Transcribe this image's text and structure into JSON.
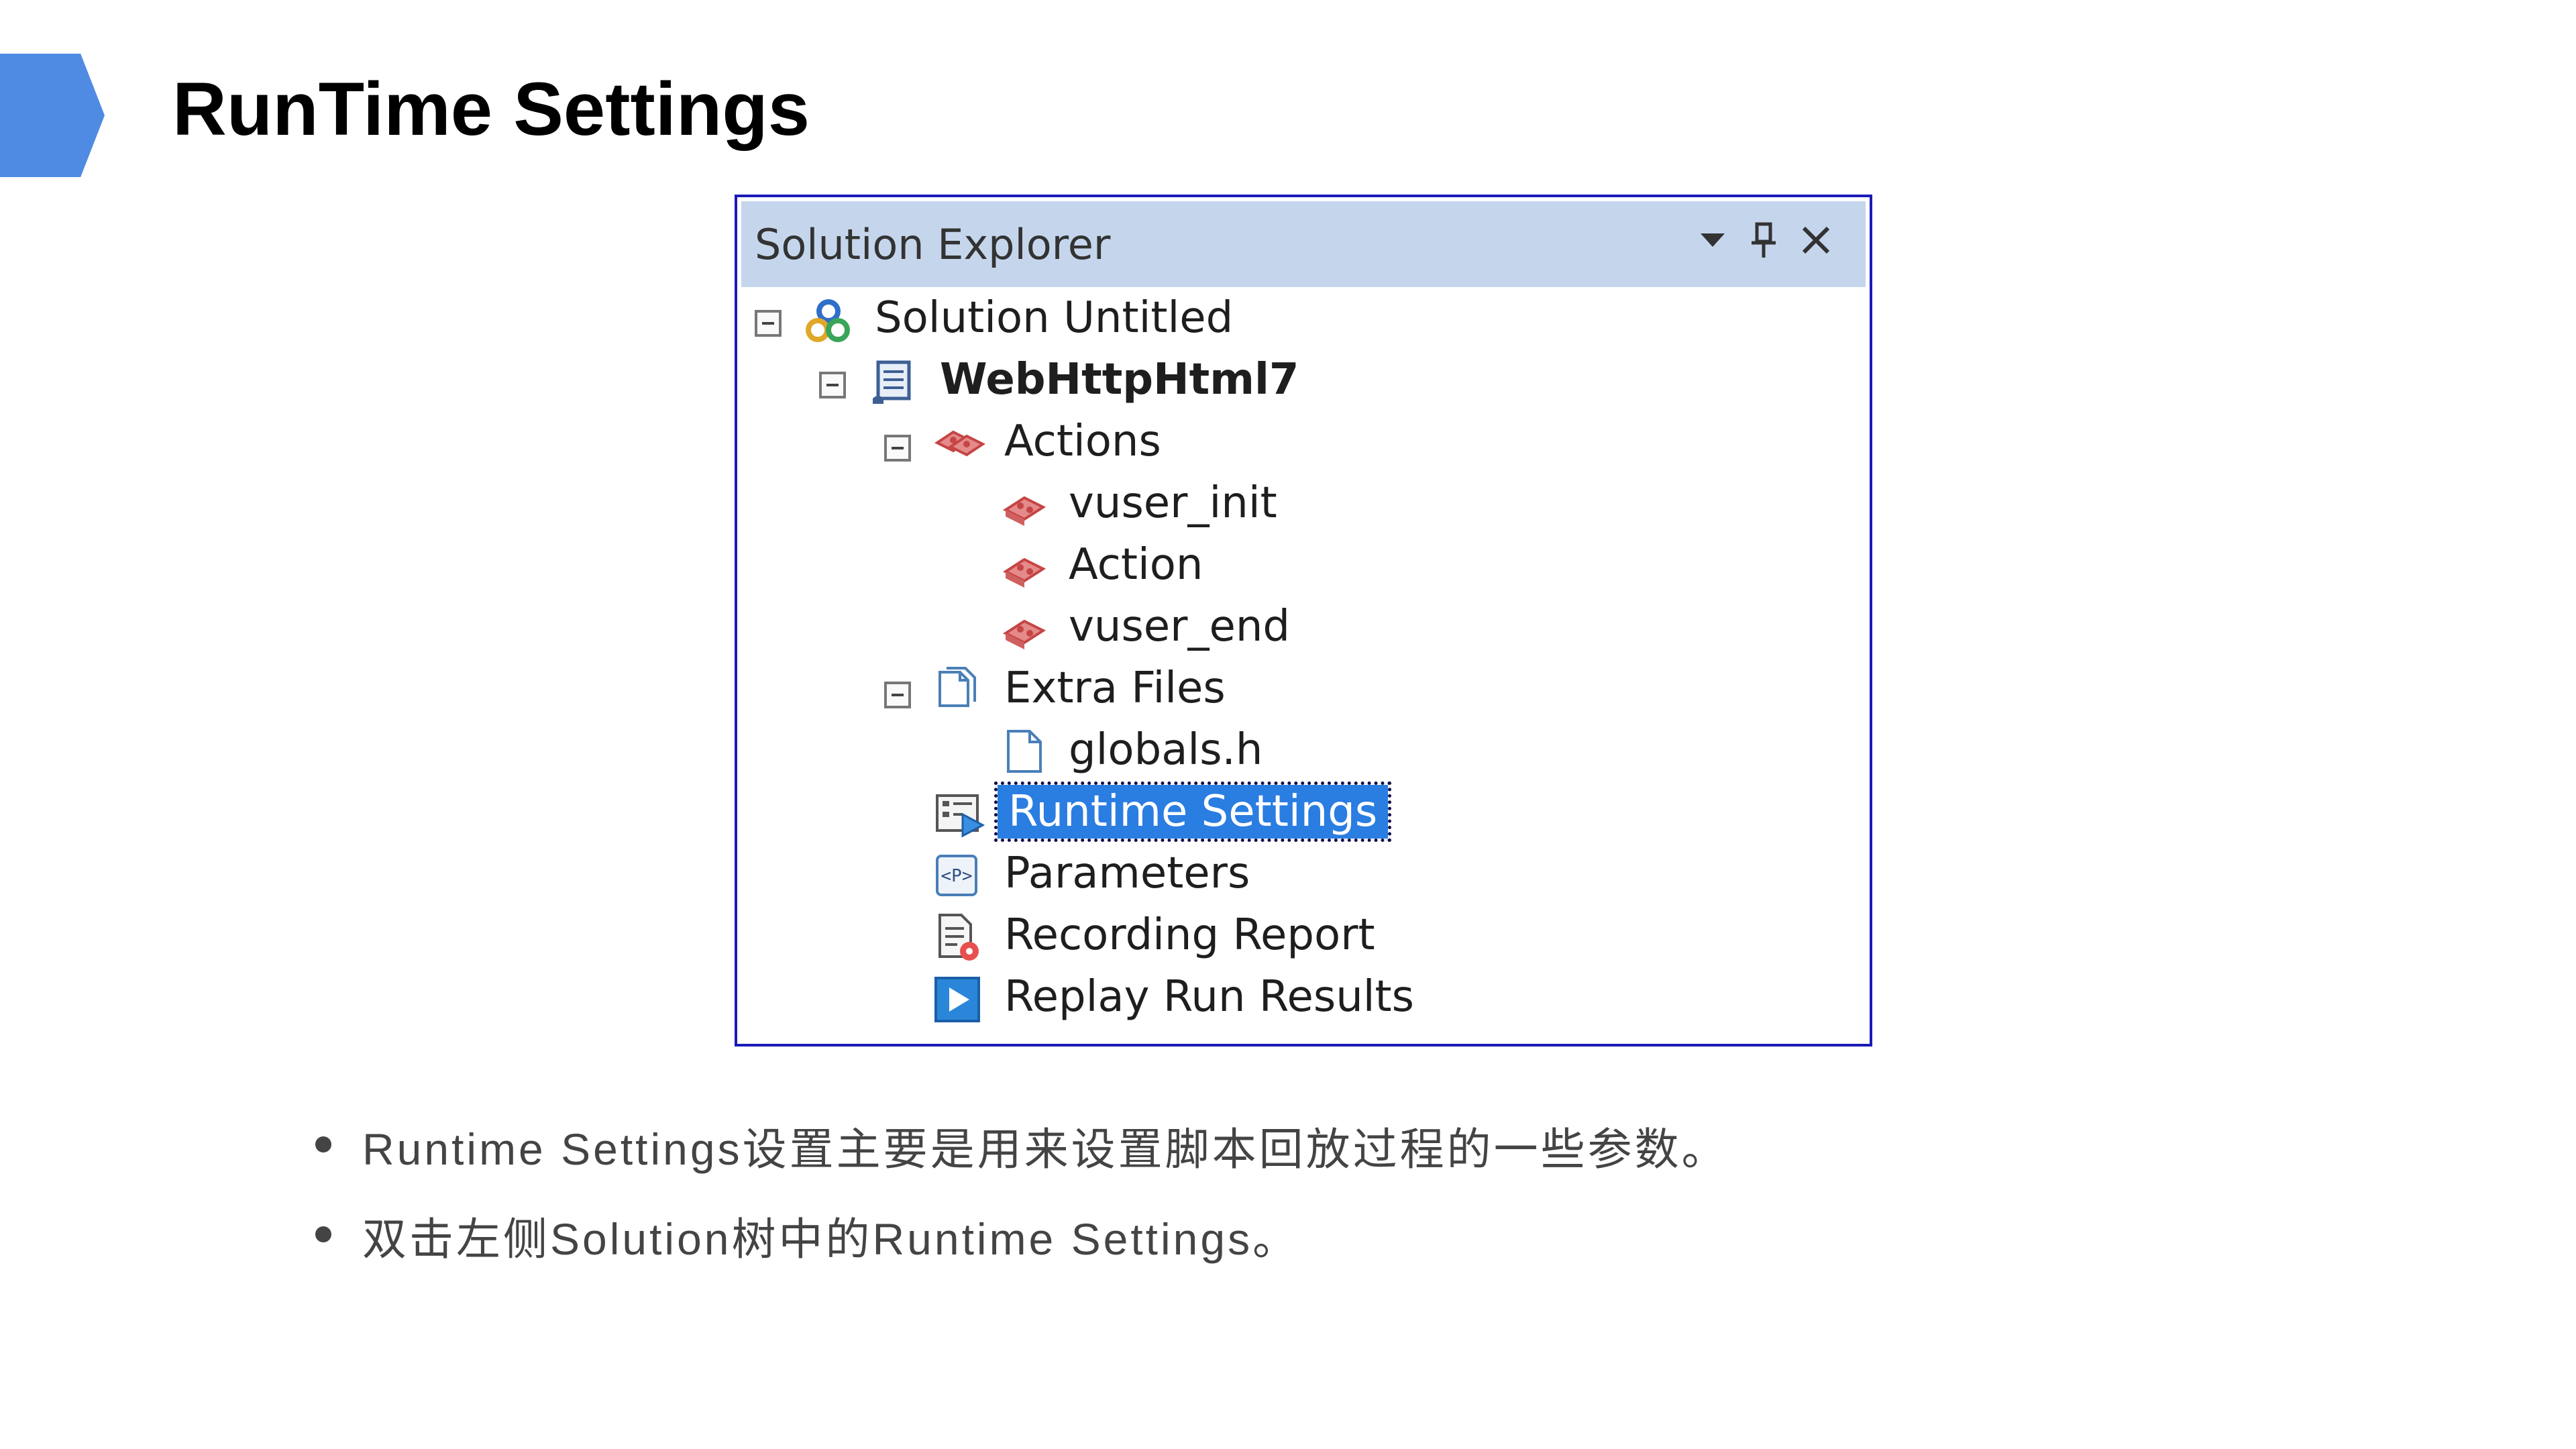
{
  "slide": {
    "title": "RunTime Settings",
    "accent_color": "#4f8be3"
  },
  "explorer": {
    "title": "Solution Explorer",
    "header_icons": [
      "dropdown-arrow-icon",
      "pin-icon",
      "close-icon"
    ],
    "tree": [
      {
        "label": "Solution Untitled",
        "icon": "solution-icon",
        "expanded": true
      },
      {
        "label": "WebHttpHtml7",
        "icon": "script-icon",
        "expanded": true,
        "bold": true
      },
      {
        "label": "Actions",
        "icon": "actions-icon",
        "expanded": true
      },
      {
        "label": "vuser_init",
        "icon": "action-icon"
      },
      {
        "label": "Action",
        "icon": "action-icon"
      },
      {
        "label": "vuser_end",
        "icon": "action-icon"
      },
      {
        "label": "Extra Files",
        "icon": "files-icon",
        "expanded": true
      },
      {
        "label": "globals.h",
        "icon": "file-icon"
      },
      {
        "label": "Runtime Settings",
        "icon": "runtime-settings-icon",
        "selected": true
      },
      {
        "label": "Parameters",
        "icon": "parameters-icon"
      },
      {
        "label": "Recording Report",
        "icon": "recording-report-icon"
      },
      {
        "label": "Replay Run Results",
        "icon": "replay-results-icon"
      }
    ],
    "selection_color": "#2a7de1",
    "header_color": "#c5d6ec",
    "border_color": "#1a1ab8"
  },
  "bullets": [
    "Runtime Settings设置主要是用来设置脚本回放过程的一些参数。",
    "双击左侧Solution树中的Runtime Settings。"
  ]
}
